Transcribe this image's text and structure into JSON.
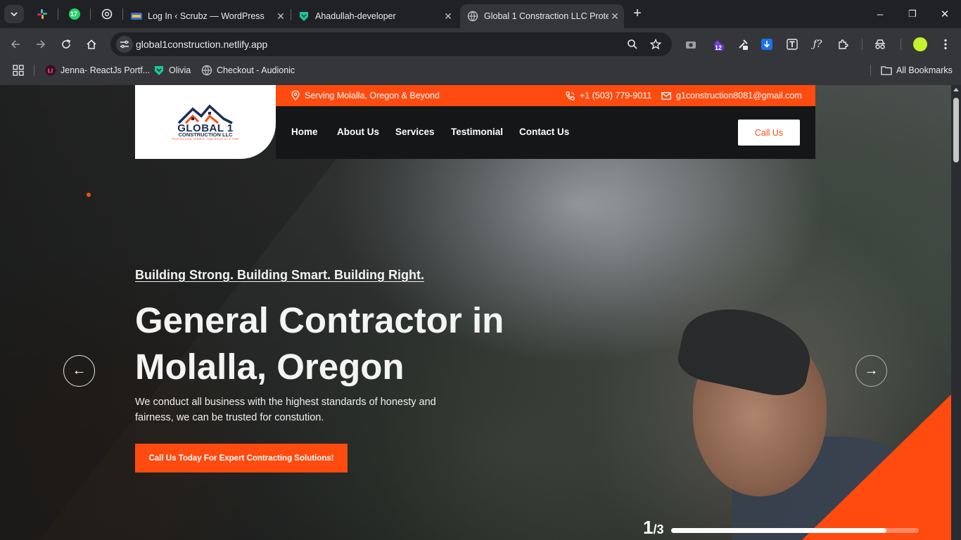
{
  "browser": {
    "tab_search_icon": "chevron-down-icon",
    "pinned_tabs": [
      {
        "name": "slack-icon"
      },
      {
        "name": "whatsapp-icon",
        "badge": "17"
      },
      {
        "name": "openai-icon"
      }
    ],
    "tabs": [
      {
        "title": "Log In ‹ Scrubz — WordPress",
        "close": "✕"
      },
      {
        "title": "Ahadullah-developer",
        "close": "✕"
      },
      {
        "title": "Global 1 Constraction LLC Prote",
        "close": "✕"
      }
    ],
    "new_tab": "+",
    "window_controls": {
      "minimize": "–",
      "maximize": "❐",
      "close": "✕"
    },
    "url": "global1construction.netlify.app",
    "extension_badge": "12",
    "bookmarks": [
      {
        "label": "Jenna- ReactJs Portf..."
      },
      {
        "label": "Olivia"
      },
      {
        "label": "Checkout - Audionic"
      }
    ],
    "all_bookmarks": "All Bookmarks"
  },
  "site": {
    "logo": {
      "title": "GLOBAL 1",
      "subtitle": "CONSTRUCTION LLC",
      "tagline": "PROTECTING HOMES, ONE ROOF AT A TIME"
    },
    "topbar": {
      "location": "Serving Molalla, Oregon & Beyond",
      "phone": "+1 (503) 779-9011",
      "email": "g1construction8081@gmail.com"
    },
    "nav": [
      "Home",
      "About Us",
      "Services",
      "Testimonial",
      "Contact Us"
    ],
    "call_button": "Call Us",
    "hero": {
      "tagline": "Building Strong. Building Smart. Building Right.",
      "headline_line1": "General Contractor in",
      "headline_line2": "Molalla, Oregon",
      "description": "We conduct all business with the highest standards of honesty and fairness, we can be trusted for constution.",
      "cta": "Call Us Today For Expert Contracting Solutions!"
    },
    "slider": {
      "current": "1",
      "total": "/3",
      "progress": 0.87,
      "prev": "←",
      "next": "→"
    },
    "accent_color": "#ff4a10"
  }
}
